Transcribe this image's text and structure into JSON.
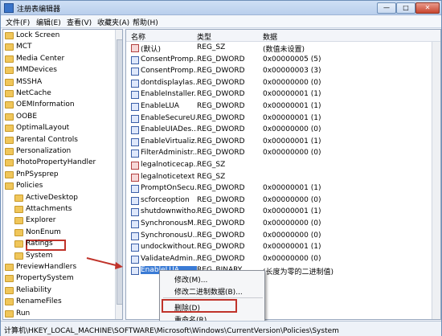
{
  "window": {
    "title": "注册表编辑器",
    "min": "—",
    "max": "□",
    "close": "✕"
  },
  "menu": [
    "文件(F)",
    "编辑(E)",
    "查看(V)",
    "收藏夹(A)",
    "帮助(H)"
  ],
  "tree": [
    {
      "label": "Lock Screen",
      "indent": 0
    },
    {
      "label": "MCT",
      "indent": 0
    },
    {
      "label": "Media Center",
      "indent": 0
    },
    {
      "label": "MMDevices",
      "indent": 0
    },
    {
      "label": "MSSHA",
      "indent": 0
    },
    {
      "label": "NetCache",
      "indent": 0
    },
    {
      "label": "OEMInformation",
      "indent": 0
    },
    {
      "label": "OOBE",
      "indent": 0
    },
    {
      "label": "OptimalLayout",
      "indent": 0
    },
    {
      "label": "Parental Controls",
      "indent": 0
    },
    {
      "label": "Personalization",
      "indent": 0
    },
    {
      "label": "PhotoPropertyHandler",
      "indent": 0
    },
    {
      "label": "PnPSysprep",
      "indent": 0
    },
    {
      "label": "Policies",
      "indent": 0
    },
    {
      "label": "ActiveDesktop",
      "indent": 1
    },
    {
      "label": "Attachments",
      "indent": 1
    },
    {
      "label": "Explorer",
      "indent": 1
    },
    {
      "label": "NonEnum",
      "indent": 1
    },
    {
      "label": "Ratings",
      "indent": 1
    },
    {
      "label": "System",
      "indent": 1
    },
    {
      "label": "PreviewHandlers",
      "indent": 0
    },
    {
      "label": "PropertySystem",
      "indent": 0
    },
    {
      "label": "Reliability",
      "indent": 0
    },
    {
      "label": "RenameFiles",
      "indent": 0
    },
    {
      "label": "Run",
      "indent": 0
    }
  ],
  "columns": {
    "name": "名称",
    "type": "类型",
    "data": "数据"
  },
  "rows": [
    {
      "name": "(默认)",
      "type": "REG_SZ",
      "data": "(数值未设置)",
      "kind": "sz"
    },
    {
      "name": "ConsentPromp...",
      "type": "REG_DWORD",
      "data": "0x00000005 (5)",
      "kind": "dw"
    },
    {
      "name": "ConsentPromp...",
      "type": "REG_DWORD",
      "data": "0x00000003 (3)",
      "kind": "dw"
    },
    {
      "name": "dontdisplaylas...",
      "type": "REG_DWORD",
      "data": "0x00000000 (0)",
      "kind": "dw"
    },
    {
      "name": "EnableInstaller...",
      "type": "REG_DWORD",
      "data": "0x00000001 (1)",
      "kind": "dw"
    },
    {
      "name": "EnableLUA",
      "type": "REG_DWORD",
      "data": "0x00000001 (1)",
      "kind": "dw"
    },
    {
      "name": "EnableSecureU...",
      "type": "REG_DWORD",
      "data": "0x00000001 (1)",
      "kind": "dw"
    },
    {
      "name": "EnableUIADes...",
      "type": "REG_DWORD",
      "data": "0x00000000 (0)",
      "kind": "dw"
    },
    {
      "name": "EnableVirtualiz...",
      "type": "REG_DWORD",
      "data": "0x00000001 (1)",
      "kind": "dw"
    },
    {
      "name": "FilterAdministr...",
      "type": "REG_DWORD",
      "data": "0x00000000 (0)",
      "kind": "dw"
    },
    {
      "name": "legalnoticecap...",
      "type": "REG_SZ",
      "data": "",
      "kind": "sz"
    },
    {
      "name": "legalnoticetext",
      "type": "REG_SZ",
      "data": "",
      "kind": "sz"
    },
    {
      "name": "PromptOnSecu...",
      "type": "REG_DWORD",
      "data": "0x00000001 (1)",
      "kind": "dw"
    },
    {
      "name": "scforceoption",
      "type": "REG_DWORD",
      "data": "0x00000000 (0)",
      "kind": "dw"
    },
    {
      "name": "shutdownwitho...",
      "type": "REG_DWORD",
      "data": "0x00000001 (1)",
      "kind": "dw"
    },
    {
      "name": "SynchronousM...",
      "type": "REG_DWORD",
      "data": "0x00000000 (0)",
      "kind": "dw"
    },
    {
      "name": "SynchronousU...",
      "type": "REG_DWORD",
      "data": "0x00000000 (0)",
      "kind": "dw"
    },
    {
      "name": "undockwithout...",
      "type": "REG_DWORD",
      "data": "0x00000001 (1)",
      "kind": "dw"
    },
    {
      "name": "ValidateAdmin...",
      "type": "REG_DWORD",
      "data": "0x00000000 (0)",
      "kind": "dw"
    },
    {
      "name": "EnableLUA",
      "type": "REG_BINARY",
      "data": "(长度为零的二进制值)",
      "kind": "dw",
      "highlight": true
    }
  ],
  "context_menu": [
    "修改(M)...",
    "修改二进制数据(B)...",
    "删除(D)",
    "重命名(R)"
  ],
  "status": "计算机\\HKEY_LOCAL_MACHINE\\SOFTWARE\\Microsoft\\Windows\\CurrentVersion\\Policies\\System"
}
